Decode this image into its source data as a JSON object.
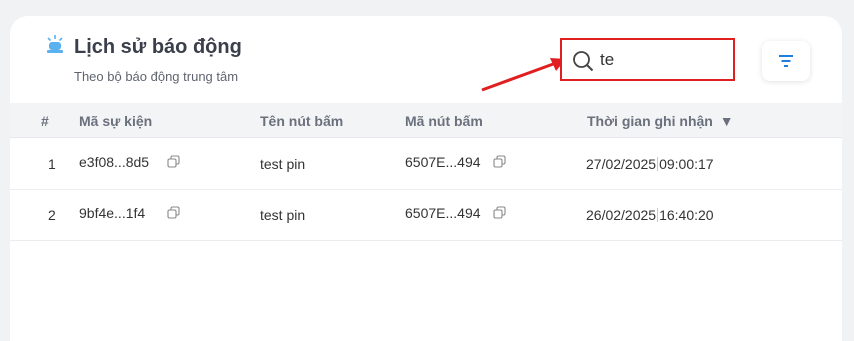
{
  "header": {
    "title": "Lịch sử báo động",
    "subtitle": "Theo bộ báo động trung tâm",
    "icon": "alarm-siren-icon",
    "icon_color": "#5bb0f0"
  },
  "search": {
    "value": "te",
    "icon": "search-icon",
    "highlight_color": "#e02020"
  },
  "filter": {
    "icon": "filter-icon",
    "icon_color": "#1f7fe0"
  },
  "table": {
    "columns": [
      "#",
      "Mã sự kiện",
      "Tên nút bấm",
      "Mã nút bấm",
      "Thời gian ghi nhận"
    ],
    "sort_indicator": "▼",
    "rows": [
      {
        "index": "1",
        "event_id": "e3f08...8d5",
        "button_name": "test pin",
        "button_id": "6507E...494",
        "date": "27/02/2025",
        "time": "09:00:17"
      },
      {
        "index": "2",
        "event_id": "9bf4e...1f4",
        "button_name": "test pin",
        "button_id": "6507E...494",
        "date": "26/02/2025",
        "time": "16:40:20"
      }
    ]
  }
}
